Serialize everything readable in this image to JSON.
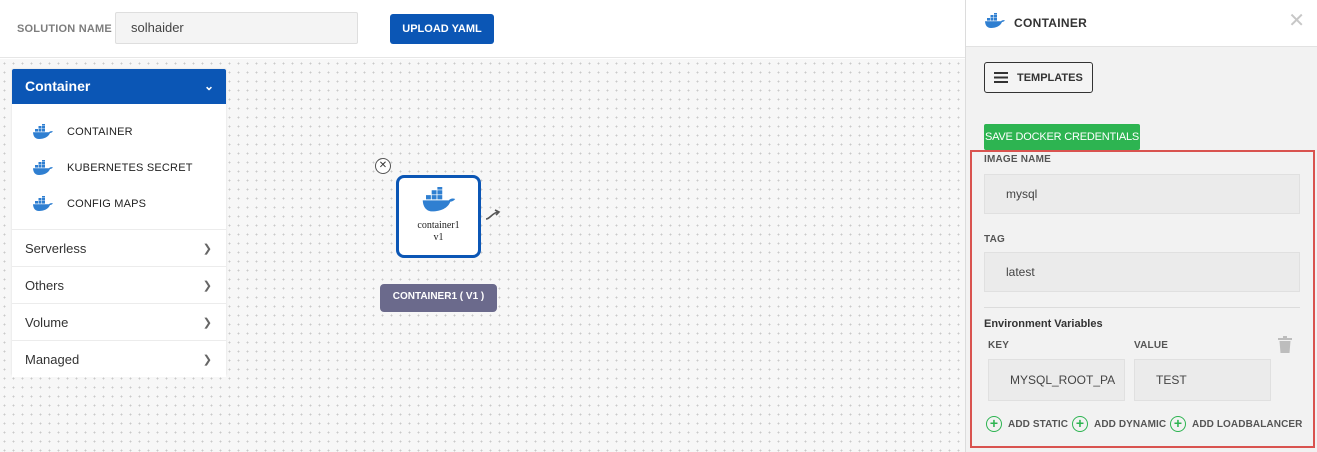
{
  "topbar": {
    "solution_label": "SOLUTION NAME",
    "solution_value": "solhaider",
    "upload_label": "UPLOAD YAML"
  },
  "sidebar": {
    "header": "Container",
    "items": [
      {
        "label": "CONTAINER",
        "icon": "docker-icon"
      },
      {
        "label": "KUBERNETES SECRET",
        "icon": "docker-icon"
      },
      {
        "label": "CONFIG MAPS",
        "icon": "docker-icon"
      }
    ],
    "sections": [
      {
        "label": "Serverless"
      },
      {
        "label": "Others"
      },
      {
        "label": "Volume"
      },
      {
        "label": "Managed"
      }
    ]
  },
  "canvas": {
    "node": {
      "name": "container1",
      "version": "v1",
      "badge": "CONTAINER1 ( V1 )"
    }
  },
  "panel": {
    "title": "CONTAINER",
    "templates_label": "TEMPLATES",
    "save_credentials_label": "SAVE DOCKER CREDENTIALS",
    "image_name_label": "IMAGE NAME",
    "image_name_value": "mysql",
    "tag_label": "TAG",
    "tag_value": "latest",
    "env_label": "Environment Variables",
    "key_label": "KEY",
    "value_label": "VALUE",
    "env_key": "MYSQL_ROOT_PA",
    "env_value": "TEST",
    "add_static": "ADD STATIC",
    "add_dynamic": "ADD DYNAMIC",
    "add_loadbalancer": "ADD LOADBALANCER"
  },
  "colors": {
    "primary": "#0b56b5",
    "success": "#2db451",
    "badge": "#6b6a8c",
    "highlight_border": "#d9534f",
    "docker_blue": "#2f7fd1"
  }
}
